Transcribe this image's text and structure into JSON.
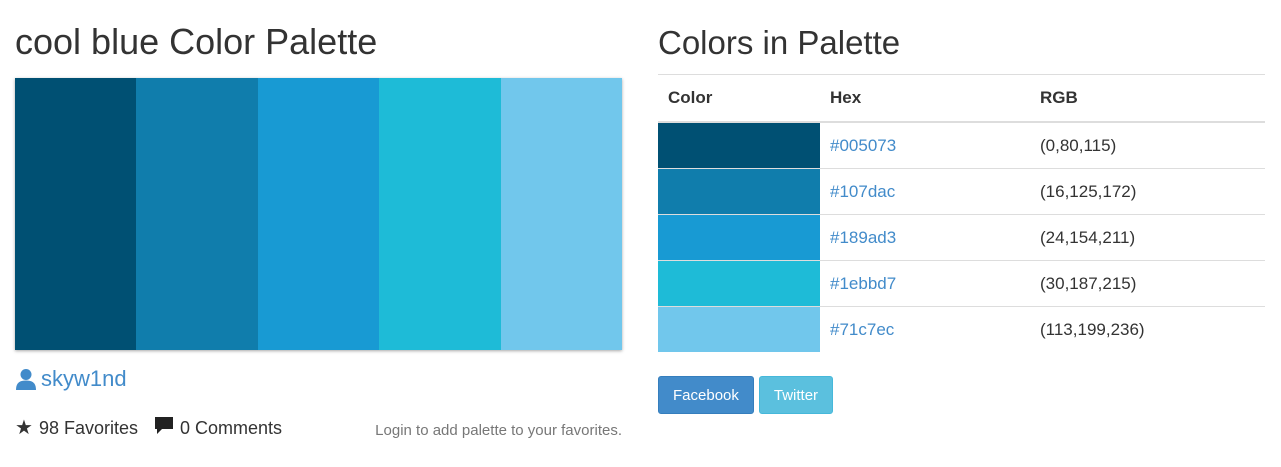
{
  "palette": {
    "title": "cool blue Color Palette",
    "author": "skyw1nd",
    "favorites_label": "98 Favorites",
    "comments_label": "0 Comments",
    "login_note": "Login to add palette to your favorites.",
    "colors": [
      "#005073",
      "#107dac",
      "#189ad3",
      "#1ebbd7",
      "#71c7ec"
    ]
  },
  "colors_section": {
    "title": "Colors in Palette",
    "headers": {
      "color": "Color",
      "hex": "Hex",
      "rgb": "RGB"
    },
    "rows": [
      {
        "hex": "#005073",
        "rgb": "(0,80,115)"
      },
      {
        "hex": "#107dac",
        "rgb": "(16,125,172)"
      },
      {
        "hex": "#189ad3",
        "rgb": "(24,154,211)"
      },
      {
        "hex": "#1ebbd7",
        "rgb": "(30,187,215)"
      },
      {
        "hex": "#71c7ec",
        "rgb": "(113,199,236)"
      }
    ]
  },
  "share": {
    "facebook_label": "Facebook",
    "twitter_label": "Twitter"
  },
  "icons": {
    "author": "user-icon",
    "favorites": "star-icon",
    "comments": "comment-icon"
  },
  "theme": {
    "link_color": "#428bca",
    "facebook_color": "#428bca",
    "twitter_color": "#5bc0de"
  }
}
